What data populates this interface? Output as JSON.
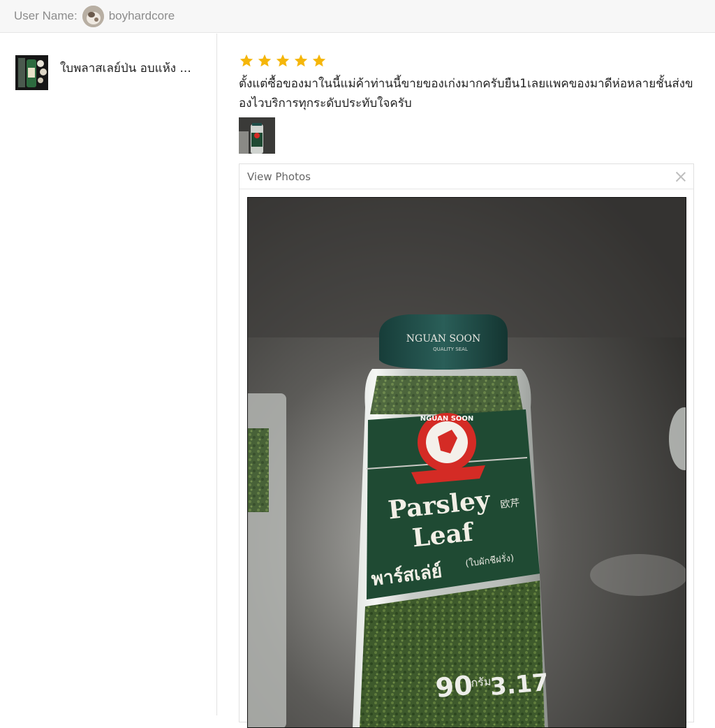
{
  "header": {
    "user_label": "User Name:",
    "username": "boyhardcore"
  },
  "product": {
    "title": "ใบพลาสเลย์ป่น อบแห้ง ..."
  },
  "review": {
    "rating": 5,
    "rating_max": 5,
    "text": "ตั้งแต่ซื้อของมาในนี้แม่ค้าท่านนี้ขายของเก่งมากครับยืน1เลยแพคของมาดีห่อหลายชั้นส่งของไวบริการทุกระดับประทับใจครับ"
  },
  "viewer": {
    "title": "View Photos"
  },
  "photo": {
    "cap_text": "NGUAN SOON",
    "cap_subtext": "QUALITY SEAL",
    "logo_text": "NGUAN SOON",
    "label_title_line1": "Parsley",
    "label_title_line2": "Leaf",
    "label_chinese": "欧芹",
    "label_thai": "พาร์สเล่ย์",
    "label_thai_small": "(ใบผักชีฝรั่ง)",
    "weight_text": "90",
    "weight_unit": "กรัม",
    "weight_oz": "3.17"
  },
  "colors": {
    "star": "#f5b60a",
    "label_green": "#1f4a33",
    "cap_teal": "#1e4d48",
    "logo_red": "#d42b25"
  }
}
